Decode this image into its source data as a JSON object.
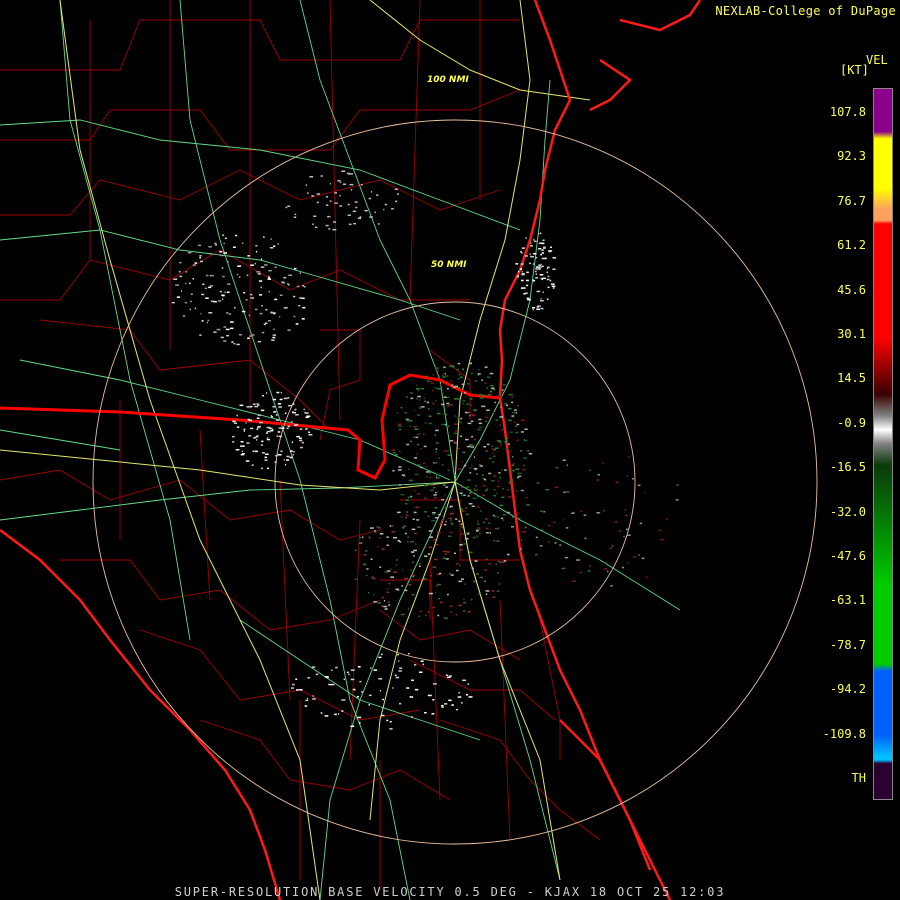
{
  "header": {
    "credit": "NEXLAB-College of DuPage"
  },
  "footer": {
    "caption": "SUPER-RESOLUTION BASE VELOCITY 0.5 DEG - KJAX 18 OCT 25 12:03"
  },
  "map": {
    "range_rings": [
      {
        "label": "100 NMI"
      },
      {
        "label": "50 NMI"
      }
    ]
  },
  "legend": {
    "product": "VEL",
    "unit": "[KT]",
    "ticks": [
      "107.8",
      "92.3",
      "76.7",
      "61.2",
      "45.6",
      "30.1",
      "14.5",
      "-0.9",
      "-16.5",
      "-32.0",
      "-47.6",
      "-63.1",
      "-78.7",
      "-94.2",
      "-109.8",
      "TH"
    ],
    "colors": {
      "purple": "#8a008a",
      "yellow": "#ffff00",
      "orange": "#ffa060",
      "red": "#ff0000",
      "darkred": "#3a0000",
      "gray": "#808080",
      "green": "#00cc00",
      "blue": "#0060ff",
      "cyan": "#00c0ff",
      "th": "#2a0030"
    }
  }
}
